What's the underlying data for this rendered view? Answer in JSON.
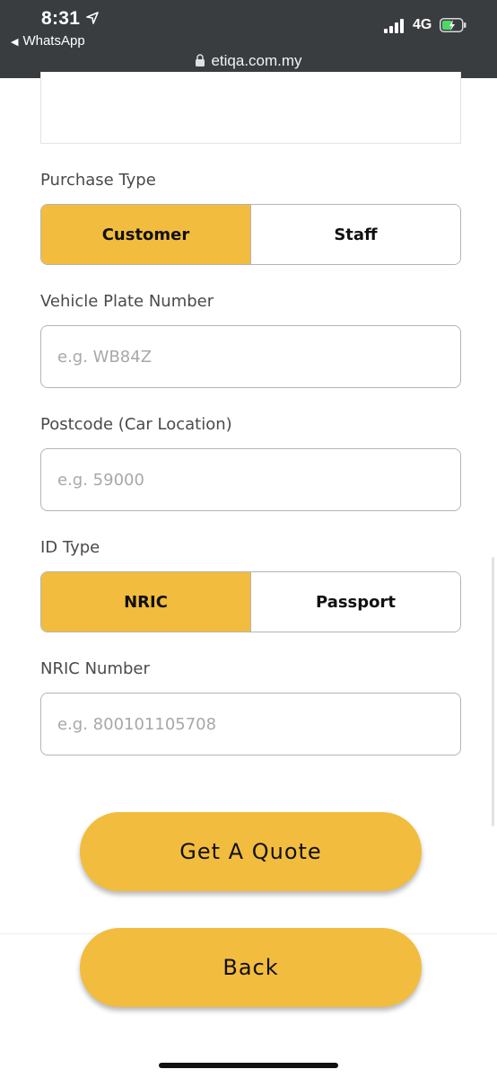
{
  "status_bar": {
    "time": "8:31",
    "back_app": "WhatsApp",
    "network": "4G",
    "url": "etiqa.com.my"
  },
  "form": {
    "purchase_type": {
      "label": "Purchase Type",
      "options": [
        "Customer",
        "Staff"
      ],
      "selected": "Customer"
    },
    "vehicle_plate": {
      "label": "Vehicle Plate Number",
      "placeholder": "e.g. WB84Z",
      "value": ""
    },
    "postcode": {
      "label": "Postcode (Car Location)",
      "placeholder": "e.g. 59000",
      "value": ""
    },
    "id_type": {
      "label": "ID Type",
      "options": [
        "NRIC",
        "Passport"
      ],
      "selected": "NRIC"
    },
    "nric_number": {
      "label": "NRIC Number",
      "placeholder": "e.g. 800101105708",
      "value": ""
    }
  },
  "actions": {
    "get_quote": "Get A Quote",
    "back": "Back"
  },
  "colors": {
    "accent": "#f2bc3e",
    "status_bar_bg": "#3a3d40",
    "border": "#b4b4b4",
    "battery_charging": "#4cd964"
  }
}
